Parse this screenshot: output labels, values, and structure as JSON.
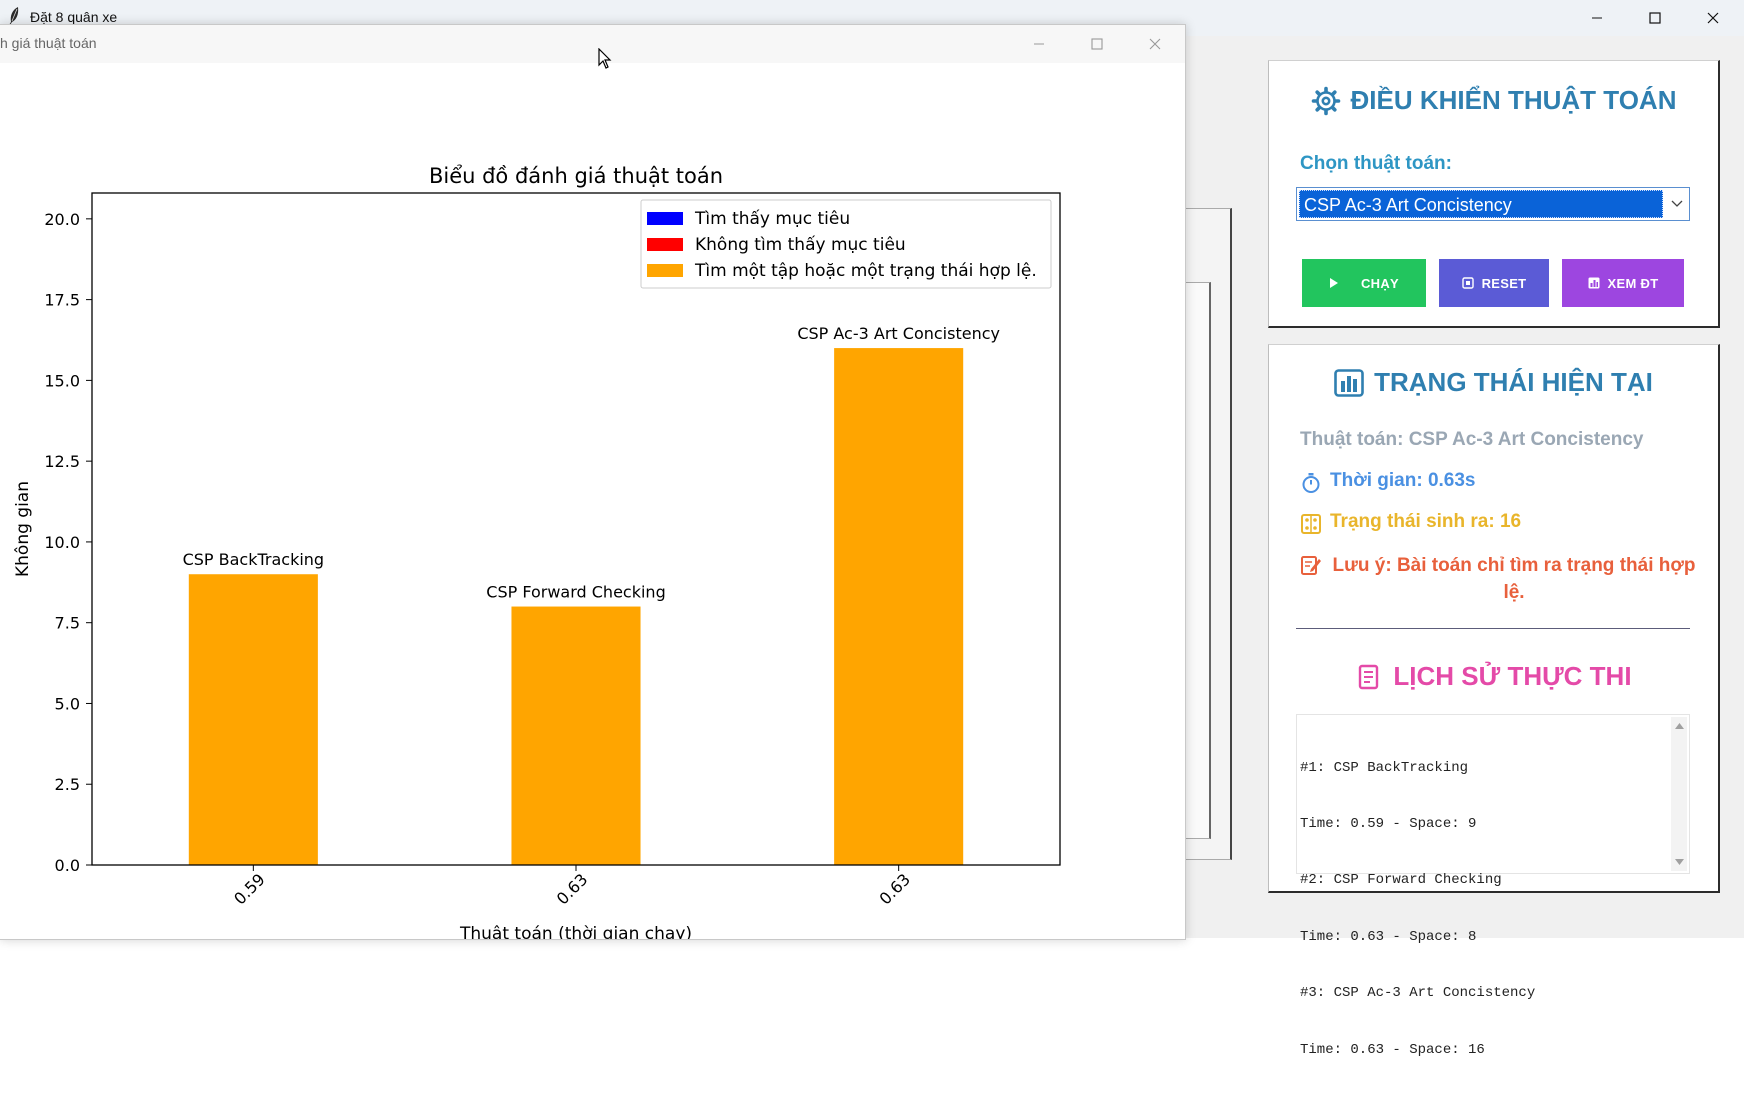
{
  "main_window": {
    "title": "Đặt 8 quân xe",
    "controls": [
      "minimize",
      "maximize",
      "close"
    ]
  },
  "chart_window": {
    "title": "h giá thuật toán"
  },
  "control_panel": {
    "title": "ĐIỀU KHIỂN THUẬT TOÁN",
    "icon": "gear-icon",
    "choose_label": "Chọn thuật toán:",
    "selected_algorithm": "CSP Ac-3 Art Concistency",
    "buttons": {
      "run": "CHẠY",
      "reset": "RESET",
      "view": "XEM ĐT"
    }
  },
  "status_panel": {
    "title": "TRẠNG THÁI HIỆN TẠI",
    "algorithm": "Thuật toán: CSP Ac-3 Art Concistency",
    "time": "Thời gian: 0.63s",
    "states": "Trạng thái sinh ra: 16",
    "note": "Lưu ý: Bài toán chỉ tìm ra trạng thái hợp lệ.",
    "history_title": "LỊCH SỬ THỰC THI",
    "history_lines": [
      "#1: CSP BackTracking",
      "Time: 0.59 - Space: 9",
      "#2: CSP Forward Checking",
      "Time: 0.63 - Space: 8",
      "#3: CSP Ac-3 Art Concistency",
      "Time: 0.63 - Space: 16"
    ]
  },
  "colors": {
    "bar": "#ffa500",
    "legend_blue": "#0000ff",
    "legend_red": "#ff0000",
    "legend_orange": "#ffa500",
    "run_button": "#22c55e",
    "reset_button": "#5b5bd6",
    "view_button": "#9d46e0"
  },
  "chart_data": {
    "type": "bar",
    "title": "Biểu đồ đánh giá thuật toán",
    "xlabel": "Thuật toán (thời gian chạy)",
    "ylabel": "Không gian",
    "categories": [
      "0.59",
      "0.63",
      "0.63"
    ],
    "bar_labels": [
      "CSP BackTracking",
      "CSP Forward Checking",
      "CSP Ac-3 Art Concistency"
    ],
    "values": [
      9,
      8,
      16
    ],
    "bar_color": "#ffa500",
    "ylim": [
      0,
      20.8
    ],
    "yticks": [
      "0.0",
      "2.5",
      "5.0",
      "7.5",
      "10.0",
      "12.5",
      "15.0",
      "17.5",
      "20.0"
    ],
    "legend": [
      {
        "label": "Tìm thấy mục tiêu",
        "color": "#0000ff"
      },
      {
        "label": "Không tìm thấy mục tiêu",
        "color": "#ff0000"
      },
      {
        "label": "Tìm một tập hoặc một trạng thái hợp lệ.",
        "color": "#ffa500"
      }
    ],
    "legend_position": "upper-right",
    "grid": false
  }
}
